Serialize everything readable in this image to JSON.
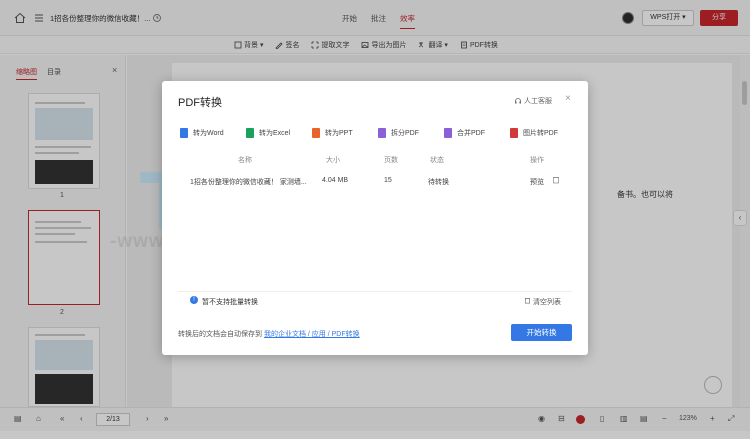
{
  "topbar": {
    "doc_title": "1招各份整理你的微信收藏！...",
    "tabs": [
      "开始",
      "批注",
      "效率"
    ],
    "active_tab": "效率",
    "wps_open_label": "WPS打开 ▾",
    "share_label": "分享"
  },
  "toolbar": {
    "items": [
      {
        "label": "背景 ▾",
        "icon": "background-icon"
      },
      {
        "label": "签名",
        "icon": "signature-icon"
      },
      {
        "label": "提取文字",
        "icon": "extract-text-icon"
      },
      {
        "label": "导出为图片",
        "icon": "export-image-icon"
      },
      {
        "label": "翻译 ▾",
        "icon": "translate-icon"
      },
      {
        "label": "PDF转换",
        "icon": "pdf-convert-icon"
      }
    ]
  },
  "sidebar": {
    "tabs": [
      "缩略图",
      "目录"
    ],
    "active_tab": "缩略图",
    "close_icon": "×",
    "page_numbers": [
      "1",
      "2"
    ]
  },
  "page": {
    "text_fragment": "备书。也可以将"
  },
  "watermark": {
    "big": "TALK 云说",
    "line": "-www.idctalk.com-国内专业云计算交流服务平台-"
  },
  "bottombar": {
    "page_input": "2/13",
    "zoom": "123%"
  },
  "modal": {
    "title": "PDF转换",
    "support_label": "人工客服",
    "close_icon": "×",
    "convert_tabs": [
      {
        "label": "转为Word",
        "color": "#3478e6"
      },
      {
        "label": "转为Excel",
        "color": "#1aa15d"
      },
      {
        "label": "转为PPT",
        "color": "#e8622c"
      },
      {
        "label": "拆分PDF",
        "color": "#8b5fd6"
      },
      {
        "label": "合并PDF",
        "color": "#8b5fd6"
      },
      {
        "label": "图片转PDF",
        "color": "#d23a3a"
      }
    ],
    "table": {
      "headers": [
        "名称",
        "大小",
        "页数",
        "状态",
        "操作"
      ],
      "rows": [
        {
          "name": "1招各份整理你的微信收藏！ 家测墙...",
          "size": "4.04 MB",
          "pages": "15",
          "status": "待转换",
          "action": "预览",
          "action_icon": "delete-icon"
        }
      ]
    },
    "note": "暂不支持批量转换",
    "clear_label": "清空列表",
    "save_path_prefix": "转换后的文档会自动保存到",
    "save_path_link": "我的企业文档 / 应用 / PDF转换",
    "start_label": "开始转换"
  }
}
